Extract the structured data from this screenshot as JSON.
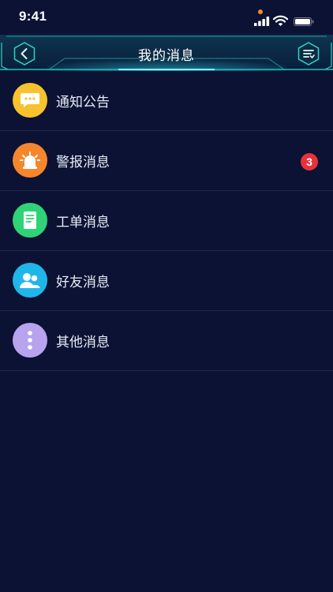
{
  "status_bar": {
    "time": "9:41"
  },
  "header": {
    "title": "我的消息"
  },
  "messages": [
    {
      "label": "通知公告",
      "icon": "chat-bubble-icon",
      "color": "#f7c22e"
    },
    {
      "label": "警报消息",
      "icon": "alarm-siren-icon",
      "color": "#f5862c",
      "badge": "3"
    },
    {
      "label": "工单消息",
      "icon": "document-icon",
      "color": "#2fd377"
    },
    {
      "label": "好友消息",
      "icon": "friends-icon",
      "color": "#1fb7ea"
    },
    {
      "label": "其他消息",
      "icon": "more-vertical-icon",
      "color": "#b7a3ee"
    }
  ],
  "colors": {
    "background": "#0b1234",
    "divider": "#1f2a4d",
    "accent": "#2ad4c8",
    "badge": "#e7323c"
  }
}
